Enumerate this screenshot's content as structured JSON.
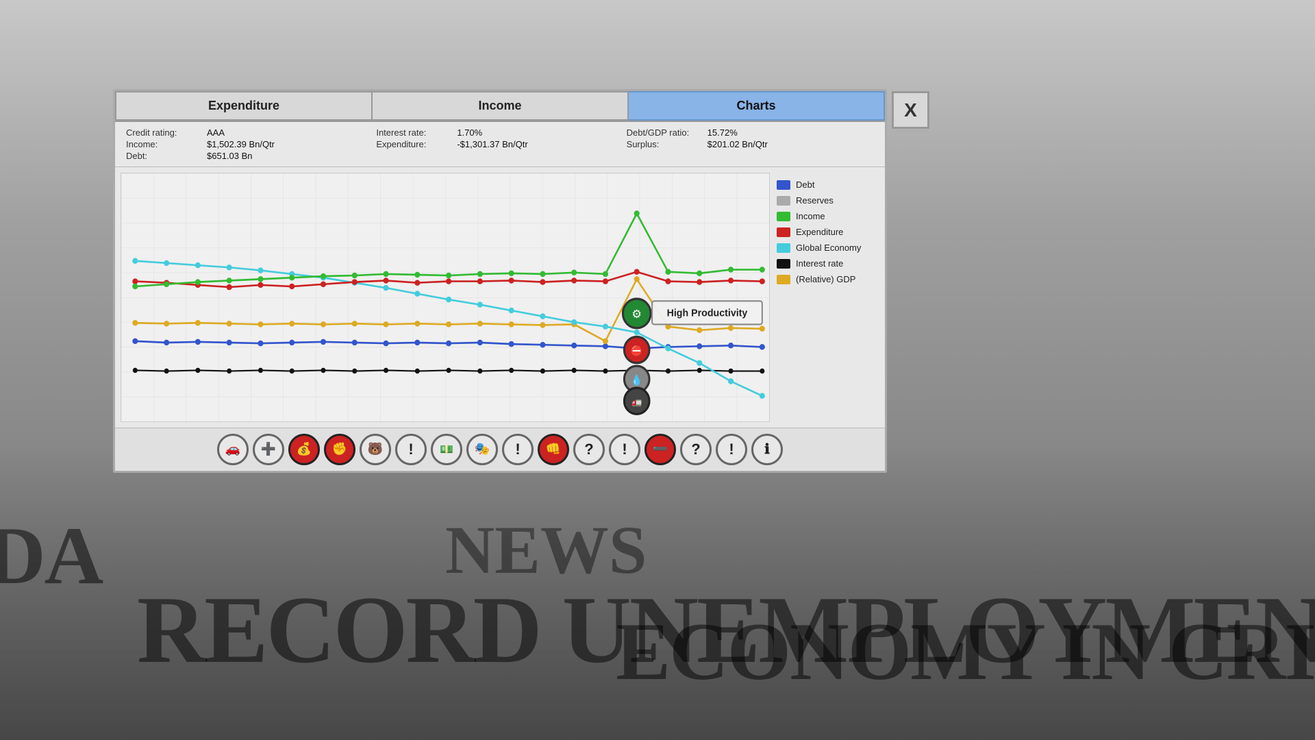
{
  "background": {
    "headlines": [
      {
        "text": "DA",
        "class": "news-1"
      },
      {
        "text": "RECORD UNEMPLOYMENT!",
        "class": "news-2"
      },
      {
        "text": "ECONOMY IN CRI",
        "class": "news-3"
      },
      {
        "text": "NEWS",
        "class": "news-4"
      }
    ]
  },
  "tabs": [
    {
      "id": "expenditure",
      "label": "Expenditure",
      "active": false
    },
    {
      "id": "income",
      "label": "Income",
      "active": false
    },
    {
      "id": "charts",
      "label": "Charts",
      "active": true
    }
  ],
  "close_button": "X",
  "stats": {
    "left": [
      {
        "label": "Credit rating:",
        "value": "AAA"
      },
      {
        "label": "Income:",
        "value": "$1,502.39 Bn/Qtr"
      },
      {
        "label": "Debt:",
        "value": "$651.03 Bn"
      }
    ],
    "middle": [
      {
        "label": "Interest rate:",
        "value": "1.70%"
      },
      {
        "label": "Expenditure:",
        "value": "-$1,301.37 Bn/Qtr"
      }
    ],
    "right": [
      {
        "label": "Debt/GDP ratio:",
        "value": "15.72%"
      },
      {
        "label": "Surplus:",
        "value": "$201.02 Bn/Qtr"
      }
    ]
  },
  "legend": [
    {
      "label": "Debt",
      "color": "#3355cc"
    },
    {
      "label": "Reserves",
      "color": "#aaaaaa"
    },
    {
      "label": "Income",
      "color": "#33bb33"
    },
    {
      "label": "Expenditure",
      "color": "#cc2222"
    },
    {
      "label": "Global Economy",
      "color": "#44ccdd"
    },
    {
      "label": "Interest rate",
      "color": "#111111"
    },
    {
      "label": "(Relative) GDP",
      "color": "#ddaa22"
    }
  ],
  "tooltip": {
    "text": "High Productivity"
  },
  "events": [
    {
      "symbol": "🚗",
      "type": "white-bg"
    },
    {
      "symbol": "➕",
      "type": "white-bg"
    },
    {
      "symbol": "💰",
      "type": "red-bg"
    },
    {
      "symbol": "🤜",
      "type": "red-bg"
    },
    {
      "symbol": "🐻",
      "type": "white-bg"
    },
    {
      "symbol": "!",
      "type": "white-bg"
    },
    {
      "symbol": "$",
      "type": "white-bg"
    },
    {
      "symbol": "🎭",
      "type": "white-bg"
    },
    {
      "symbol": "!",
      "type": "white-bg"
    },
    {
      "symbol": "👊",
      "type": "red-bg"
    },
    {
      "symbol": "?",
      "type": "white-bg"
    },
    {
      "symbol": "!",
      "type": "white-bg"
    },
    {
      "symbol": "➖",
      "type": "red-bg"
    },
    {
      "symbol": "?",
      "type": "white-bg"
    },
    {
      "symbol": "!",
      "type": "white-bg"
    },
    {
      "symbol": "ℹ",
      "type": "white-bg"
    }
  ]
}
